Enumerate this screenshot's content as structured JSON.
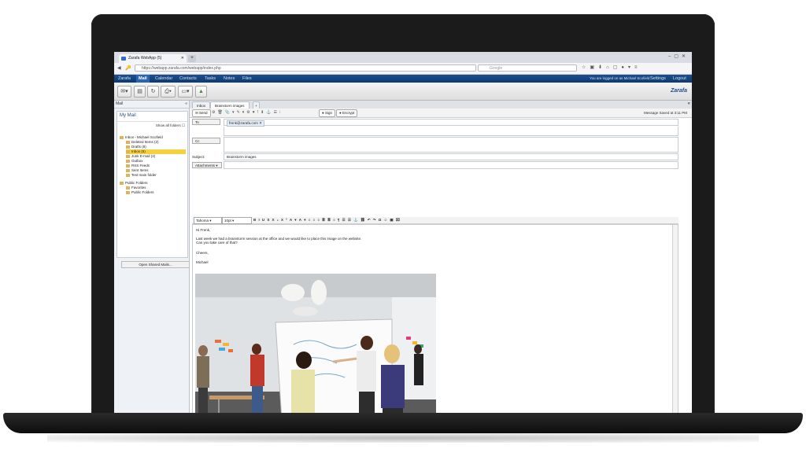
{
  "browser": {
    "tab_title": "Zarafa WebApp (5)",
    "url": "https://webapp.zarafa.com/webapp/index.php",
    "search_placeholder": "Google"
  },
  "app_nav": {
    "items": [
      "Zarafa",
      "Mail",
      "Calendar",
      "Contacts",
      "Tasks",
      "Notes",
      "Files"
    ],
    "logged_in": "You are logged on as Michael Scofield",
    "settings": "Settings",
    "logout": "Logout"
  },
  "brand": "Zarafa",
  "left_pane": {
    "header": "Mail",
    "my_mail": "My Mail",
    "show_all": "Show all folders",
    "tree": [
      {
        "label": "Inbox - Michael Scofield",
        "indent": 0
      },
      {
        "label": "Deleted Items (2)",
        "indent": 1
      },
      {
        "label": "Drafts (8)",
        "indent": 1
      },
      {
        "label": "Inbox (5)",
        "indent": 1,
        "selected": true
      },
      {
        "label": "Junk E-mail (2)",
        "indent": 1
      },
      {
        "label": "Outbox",
        "indent": 1
      },
      {
        "label": "RSS Feeds",
        "indent": 1
      },
      {
        "label": "Sent Items",
        "indent": 1
      },
      {
        "label": "Test main folder",
        "indent": 1
      },
      {
        "label": "Public Folders",
        "indent": 0
      },
      {
        "label": "Favorites",
        "indent": 1
      },
      {
        "label": "Public Folders",
        "indent": 1
      }
    ],
    "open_shared": "Open Shared Mails..."
  },
  "content_tabs": [
    "Inbox",
    "Brainstorm images"
  ],
  "mail_toolbar": {
    "send": "Send",
    "sign": "Sign",
    "encrypt": "Encrypt",
    "saved": "Message Saved at 3:11 PM"
  },
  "compose": {
    "to_label": "To",
    "to_value": "frenk@zarafa.com",
    "cc_label": "Cc",
    "subject_label": "Subject:",
    "subject_value": "Brainstorm images",
    "attachments_label": "Attachments",
    "font": "Tahoma",
    "size": "10pt",
    "body_lines": [
      "Hi Frenk,",
      "Last week we had a brainstorm session at the office and we would like to place this image on the website.",
      "Can you take care of that?",
      "Cheers,",
      "Michael"
    ]
  },
  "colors": {
    "nav_blue": "#1c4f8f",
    "selected_folder": "#f4d23e"
  }
}
